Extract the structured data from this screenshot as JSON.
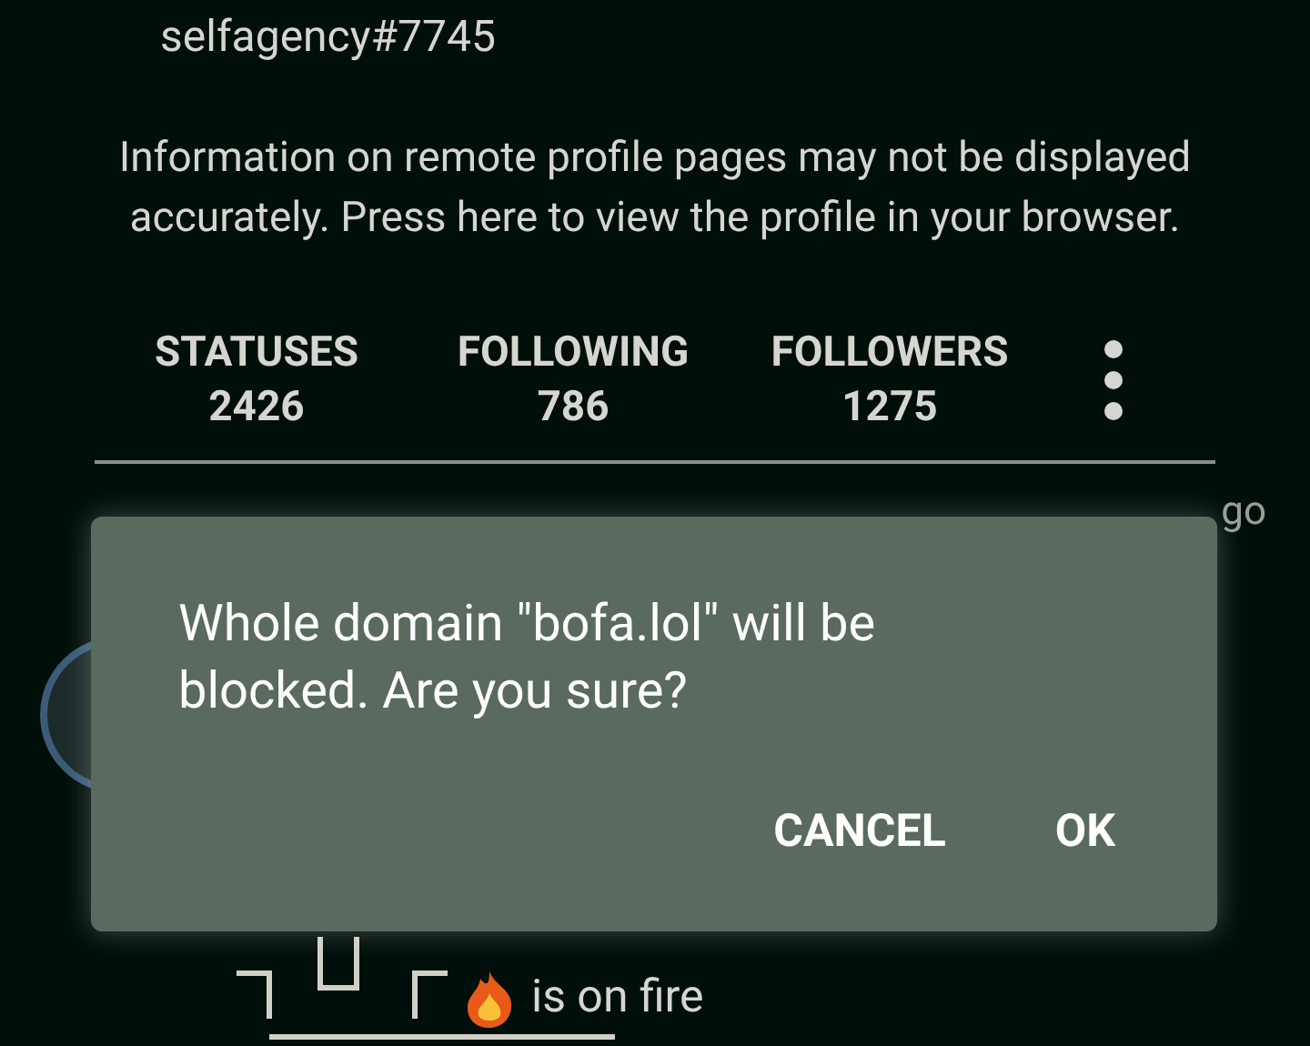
{
  "profile": {
    "username": "selfagency#7745",
    "remote_notice": "Information on remote profile pages may not be displayed accurately. Press here to view the profile in your browser.",
    "stats": [
      {
        "label": "STATUSES",
        "value": "2426"
      },
      {
        "label": "FOLLOWING",
        "value": "786"
      },
      {
        "label": "FOLLOWERS",
        "value": "1275"
      }
    ]
  },
  "post": {
    "time_fragment": "go",
    "text_line": "is on fire"
  },
  "dialog": {
    "message": "Whole domain \"bofa.lol\" will be blocked. Are you sure?",
    "buttons": [
      "CANCEL",
      "OK"
    ]
  }
}
